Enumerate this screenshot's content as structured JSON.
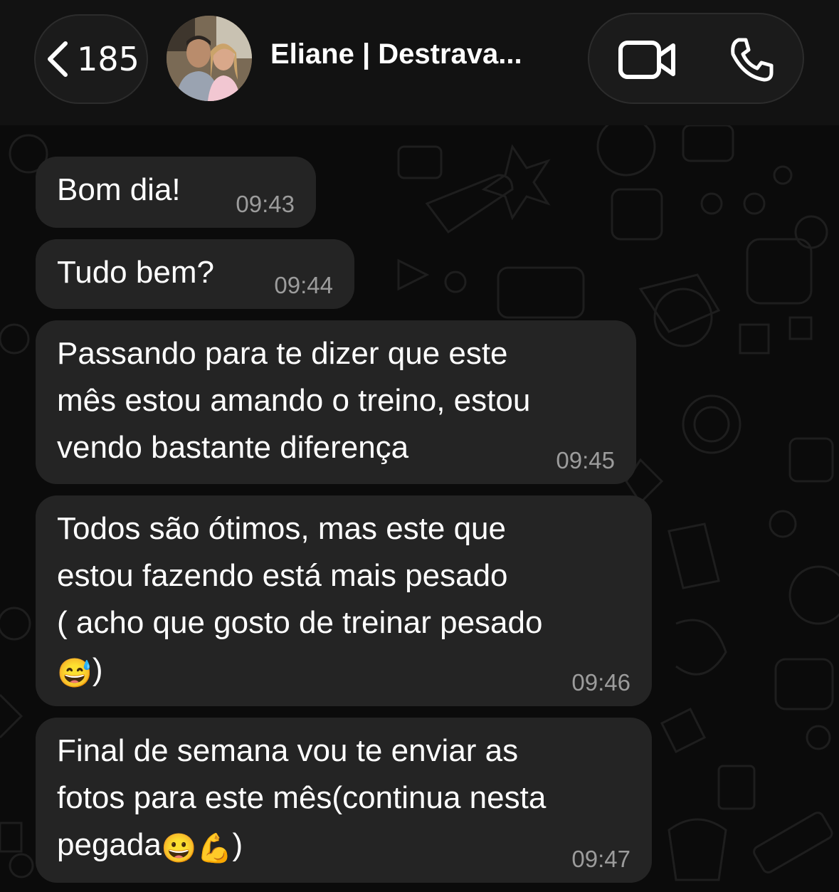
{
  "header": {
    "back_count": "185",
    "contact_name": "Eliane | Destrava..."
  },
  "messages": [
    {
      "text": "Bom dia!",
      "time": "09:43"
    },
    {
      "text": "Tudo bem?",
      "time": "09:44"
    },
    {
      "text": "Passando para te dizer que este\nmês estou amando o treino, estou\nvendo bastante diferença",
      "time": "09:45"
    },
    {
      "text": "Todos são ótimos, mas este que\nestou fazendo está mais pesado\n( acho que gosto de treinar pesado\n",
      "emoji_line": "😅",
      "after": ")",
      "time": "09:46"
    },
    {
      "text": "Final de semana vou te enviar as\nfotos para este mês(continua nesta\npegada",
      "emoji_line": "😀💪",
      "after": ")",
      "time": "09:47"
    }
  ],
  "colors": {
    "bubble": "#242424",
    "header": "#121212",
    "background": "#0b0b0b",
    "timestamp": "#9c9c9c"
  },
  "icons": [
    "chevron-left-icon",
    "video-call-icon",
    "phone-call-icon"
  ]
}
